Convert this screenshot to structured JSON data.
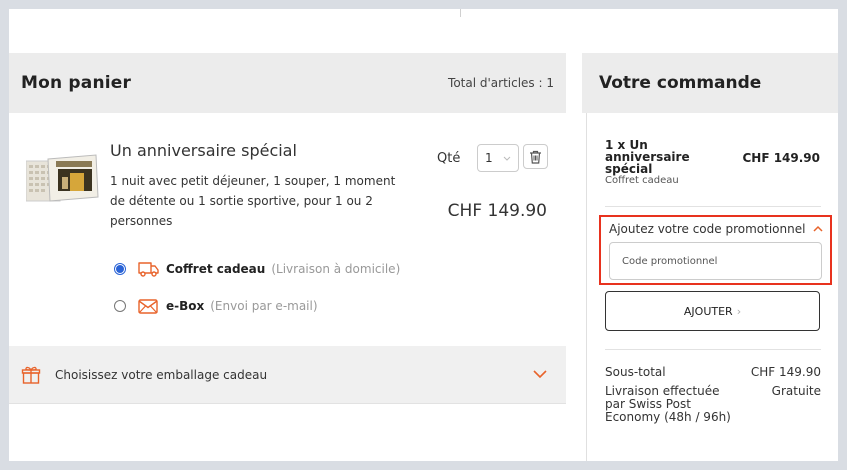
{
  "cart": {
    "title": "Mon panier",
    "total_label": "Total d'articles : 1"
  },
  "item": {
    "name": "Un anniversaire spécial",
    "description": "1 nuit avec petit déjeuner, 1 souper, 1 moment de détente ou 1 sortie sportive, pour 1 ou 2 personnes",
    "qty_label": "Qté",
    "qty_value": "1",
    "price": "CHF 149.90",
    "options": [
      {
        "label": "Coffret cadeau",
        "sub": "(Livraison à domicile)",
        "selected": true,
        "icon": "truck-icon"
      },
      {
        "label": "e-Box",
        "sub": "(Envoi par e-mail)",
        "selected": false,
        "icon": "envelope-icon"
      }
    ]
  },
  "wrapping": {
    "label": "Choisissez votre emballage cadeau",
    "icon": "gift-icon"
  },
  "order": {
    "title": "Votre commande",
    "line_item": {
      "name": "1 x Un anniversaire spécial",
      "sub": "Coffret cadeau",
      "price": "CHF 149.90"
    },
    "promo": {
      "label": "Ajoutez votre code promotionnel",
      "placeholder": "Code promotionnel"
    },
    "add_button": "AJOUTER",
    "subtotal": {
      "label": "Sous-total",
      "value": "CHF 149.90"
    },
    "shipping": {
      "label": "Livraison effectuée par Swiss Post Economy (48h / 96h)",
      "value": "Gratuite"
    }
  },
  "colors": {
    "accent_orange": "#e8632b",
    "highlight_red": "#e8321e",
    "radio_blue": "#2a63d6",
    "panel_gray": "#ececec"
  }
}
